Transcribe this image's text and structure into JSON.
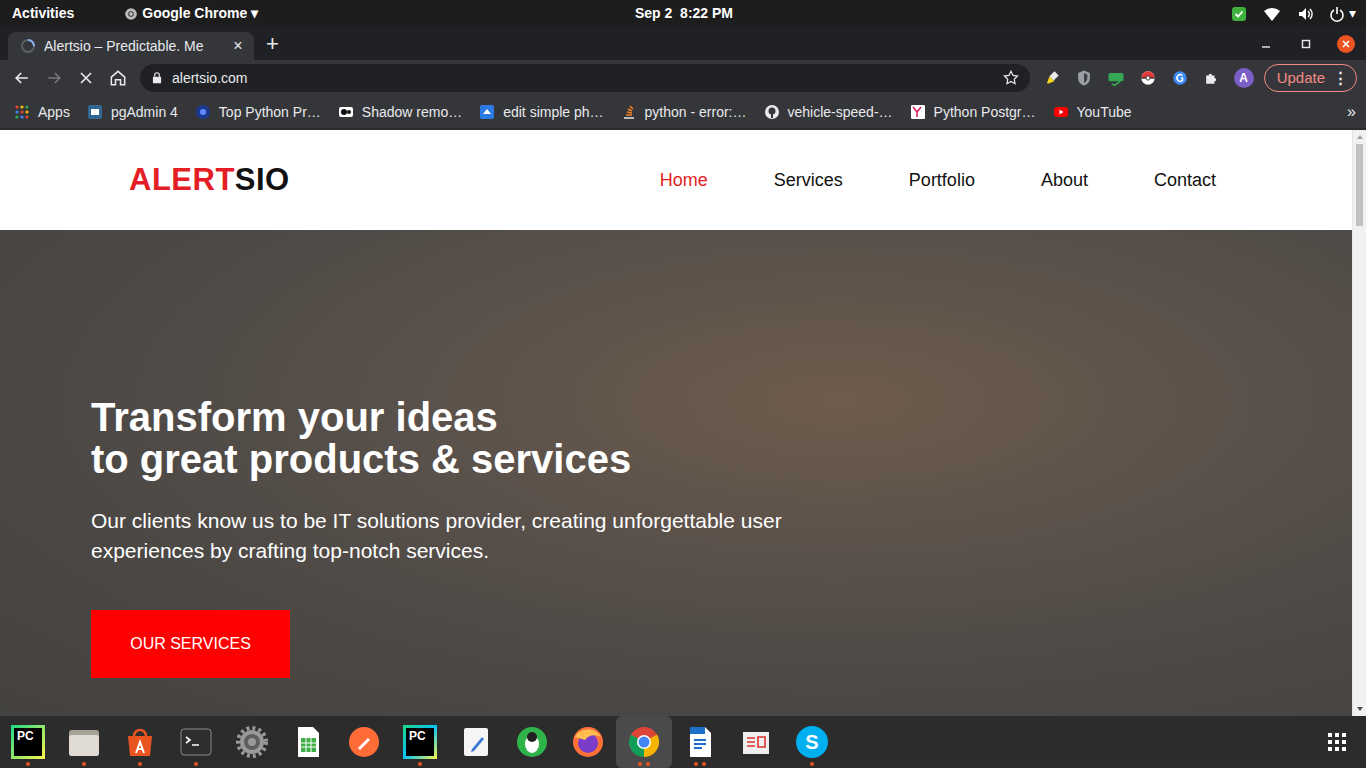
{
  "topbar": {
    "activities": "Activities",
    "app_menu": "Google Chrome",
    "app_menu_arrow": "▾",
    "clock": "Sep 2  8:22 PM",
    "tray_arrow": "▾"
  },
  "browser": {
    "tabs": [
      {
        "label": "Alertsio – Predictable. Me",
        "selected": true,
        "close": "×"
      }
    ],
    "new_tab": "+",
    "back_enabled": true,
    "forward_enabled": false,
    "loading": true,
    "address": "alertsio.com",
    "bookmarked": false,
    "avatar": "A",
    "update": "Update",
    "menu": "⋮",
    "bookmarks": [
      {
        "label": "Apps",
        "kind": "apps"
      },
      {
        "label": "pgAdmin 4",
        "kind": "pgadmin"
      },
      {
        "label": "Top Python Pr…",
        "kind": "web"
      },
      {
        "label": "Shadow remo…",
        "kind": "dark"
      },
      {
        "label": "edit simple ph…",
        "kind": "bird"
      },
      {
        "label": "python - error:…",
        "kind": "stack"
      },
      {
        "label": "vehicle-speed-…",
        "kind": "github"
      },
      {
        "label": "Python Postgr…",
        "kind": "yn"
      },
      {
        "label": "YouTube",
        "kind": "youtube"
      }
    ],
    "bookmarks_more": "»"
  },
  "site": {
    "logo": [
      {
        "text": "ALERT",
        "color": "#e31e24"
      },
      {
        "text": "SIO",
        "color": "#111111"
      }
    ],
    "nav": [
      {
        "label": "Home",
        "selected": true
      },
      {
        "label": "Services",
        "selected": false
      },
      {
        "label": "Portfolio",
        "selected": false
      },
      {
        "label": "About",
        "selected": false
      },
      {
        "label": "Contact",
        "selected": false
      }
    ],
    "hero": {
      "title_lines": [
        "Transform your ideas",
        "to great products & services"
      ],
      "text": "Our clients know us to be IT solutions provider, creating unforgettable user experiences by crafting top-notch services.",
      "button": "OUR SERVICES"
    }
  },
  "scrollbar": {
    "position": 0
  },
  "dock": {
    "apps": [
      {
        "kind": "pycharm",
        "mark": "PC",
        "windows": 1,
        "focused": false
      },
      {
        "kind": "files",
        "windows": 1,
        "focused": false
      },
      {
        "kind": "software",
        "windows": 1,
        "focused": false
      },
      {
        "kind": "terminal",
        "windows": 1,
        "focused": false
      },
      {
        "kind": "settings",
        "windows": 0,
        "focused": false
      },
      {
        "kind": "calc",
        "windows": 0,
        "focused": false
      },
      {
        "kind": "postman",
        "windows": 0,
        "focused": false
      },
      {
        "kind": "pycharm-pro",
        "mark": "PC",
        "windows": 1,
        "focused": false
      },
      {
        "kind": "editor",
        "windows": 0,
        "focused": false
      },
      {
        "kind": "penguin",
        "windows": 0,
        "focused": false
      },
      {
        "kind": "firefox",
        "windows": 0,
        "focused": false
      },
      {
        "kind": "chrome",
        "windows": 2,
        "focused": true
      },
      {
        "kind": "writer",
        "windows": 2,
        "focused": false
      },
      {
        "kind": "viewer",
        "windows": 0,
        "focused": false
      },
      {
        "kind": "skype",
        "mark": "S",
        "windows": 1,
        "focused": false
      }
    ]
  }
}
